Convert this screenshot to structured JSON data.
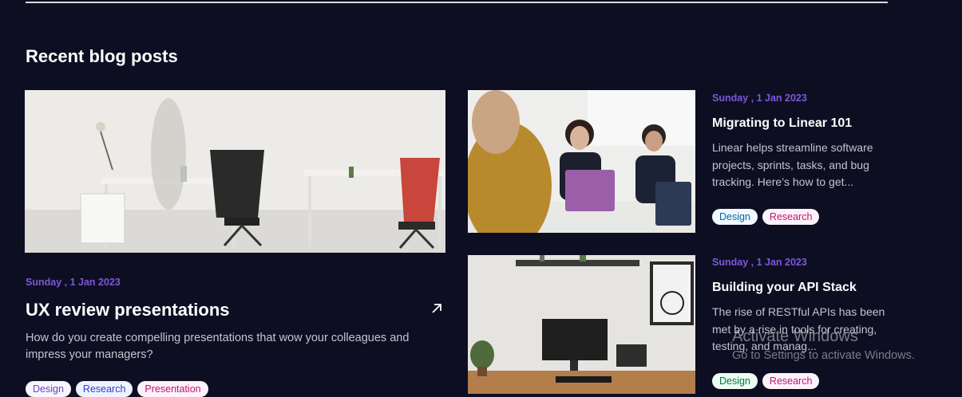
{
  "section": {
    "title": "Recent blog posts"
  },
  "featured": {
    "date": "Sunday , 1 Jan 2023",
    "title": "UX review presentations",
    "excerpt": "How do you create compelling presentations that wow your colleagues and impress your managers?",
    "tags": [
      "Design",
      "Research",
      "Presentation"
    ],
    "arrow_icon": "arrow-up-right-icon"
  },
  "posts": [
    {
      "date": "Sunday , 1 Jan 2023",
      "title": "Migrating to Linear 101",
      "excerpt": "Linear helps streamline software projects, sprints, tasks, and bug tracking. Here’s how to get...",
      "tags": [
        "Design",
        "Research"
      ]
    },
    {
      "date": "Sunday , 1 Jan 2023",
      "title": "Building your API Stack",
      "excerpt": "The rise of RESTful APIs has been met by a rise in tools for creating, testing, and manag...",
      "tags": [
        "Design",
        "Research"
      ]
    }
  ],
  "watermark": {
    "line1": "Activate Windows",
    "line2": "Go to Settings to activate Windows."
  },
  "colors": {
    "background": "#0d0e22",
    "date": "#7f56d9",
    "tag_design_text": "#026aa2",
    "tag_design_bg": "#f0f9ff",
    "tag_research_text": "#3538cd",
    "tag_research_bg": "#eef4ff",
    "tag_presentation_text": "#c11574",
    "tag_presentation_bg": "#fdf2fa"
  }
}
